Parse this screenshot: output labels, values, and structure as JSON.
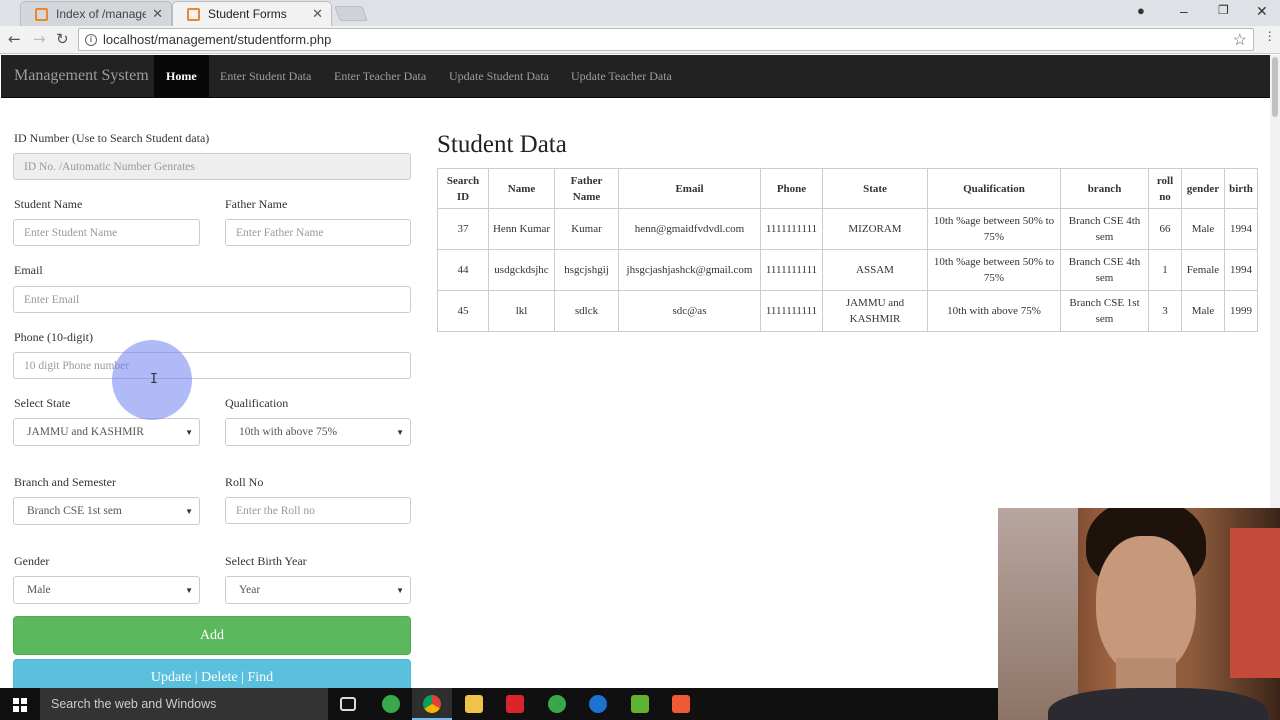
{
  "browser": {
    "tabs": [
      {
        "title": "Index of /management/",
        "active": false
      },
      {
        "title": "Student Forms",
        "active": true
      }
    ],
    "url": "localhost/management/studentform.php"
  },
  "navbar": {
    "brand": "Management System",
    "links": [
      "Home",
      "Enter Student Data",
      "Enter Teacher Data",
      "Update Student Data",
      "Update Teacher Data"
    ],
    "active": "Home"
  },
  "form": {
    "id_label": "ID Number (Use to Search Student data)",
    "id_placeholder": "ID No. /Automatic Number Genrates",
    "student_name_label": "Student Name",
    "student_name_placeholder": "Enter Student Name",
    "father_name_label": "Father Name",
    "father_name_placeholder": "Enter Father Name",
    "email_label": "Email",
    "email_placeholder": "Enter Email",
    "phone_label": "Phone (10-digit)",
    "phone_placeholder": "10 digit Phone number",
    "state_label": "Select State",
    "state_value": "JAMMU and KASHMIR",
    "qualification_label": "Qualification",
    "qualification_value": "10th with above 75%",
    "branch_label": "Branch and Semester",
    "branch_value": "Branch CSE 1st sem",
    "roll_label": "Roll No",
    "roll_placeholder": "Enter the Roll no",
    "gender_label": "Gender",
    "gender_value": "Male",
    "birth_label": "Select Birth Year",
    "birth_value": "Year",
    "add_button": "Add",
    "update_button": "Update | Delete | Find"
  },
  "student_table": {
    "title": "Student Data",
    "headers": [
      "Search ID",
      "Name",
      "Father Name",
      "Email",
      "Phone",
      "State",
      "Qualification",
      "branch",
      "roll no",
      "gender",
      "birth"
    ],
    "rows": [
      [
        "37",
        "Henn Kumar",
        "Kumar",
        "henn@gmaidfvdvdl.com",
        "1111111111",
        "MIZORAM",
        "10th %age between 50% to 75%",
        "Branch CSE 4th sem",
        "66",
        "Male",
        "1994"
      ],
      [
        "44",
        "usdgckdsjhc",
        "hsgcjshgij",
        "jhsgcjashjashck@gmail.com",
        "1111111111",
        "ASSAM",
        "10th %age between 50% to 75%",
        "Branch CSE 4th sem",
        "1",
        "Female",
        "1994"
      ],
      [
        "45",
        "lkl",
        "sdlck",
        "sdc@as",
        "1111111111",
        "JAMMU and KASHMIR",
        "10th with above 75%",
        "Branch CSE 1st sem",
        "3",
        "Male",
        "1999"
      ]
    ]
  },
  "taskbar": {
    "search_text": "Search the web and Windows"
  }
}
